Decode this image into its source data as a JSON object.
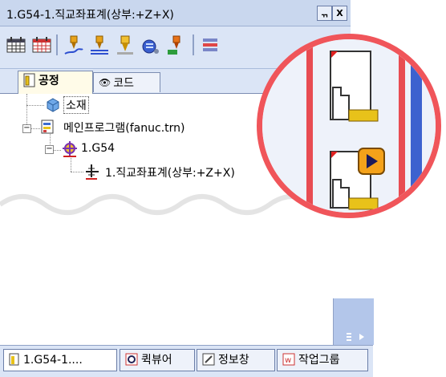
{
  "window": {
    "title": "1.G54-1.직교좌표계(상부:+Z+X)",
    "pin_label": "ᆩ",
    "close_label": "X"
  },
  "toolbar": {
    "icons": [
      "calendar-grid-icon",
      "calendar-red-icon",
      "tool-path-icon",
      "tool-stack-icon",
      "tool-yellow-icon",
      "tool-blue-icon",
      "tool-orange-icon",
      "layers-icon"
    ]
  },
  "tabs": [
    {
      "label": "공정",
      "icon": "process-icon",
      "active": true
    },
    {
      "label": "코드",
      "icon": "eye-icon",
      "active": false
    }
  ],
  "tree": {
    "stock": "소재",
    "main_program": "메인프로그램(fanuc.trn)",
    "g54": "1.G54",
    "coord": "1.직교좌표계(상부:+Z+X)"
  },
  "bottom_tabs": [
    {
      "label": "1.G54-1....",
      "icon": "document-icon",
      "active": true
    },
    {
      "label": "퀵뷰어",
      "icon": "quickviewer-icon",
      "active": false
    },
    {
      "label": "정보창",
      "icon": "info-window-icon",
      "active": false
    },
    {
      "label": "작업그룹",
      "icon": "workgroup-icon",
      "active": false
    }
  ],
  "colors": {
    "zoom_ring": "#f0555a",
    "titlebar": "#c9d7ee",
    "toolbar": "#dbe5f6",
    "accent_yellow": "#e8c21a"
  }
}
